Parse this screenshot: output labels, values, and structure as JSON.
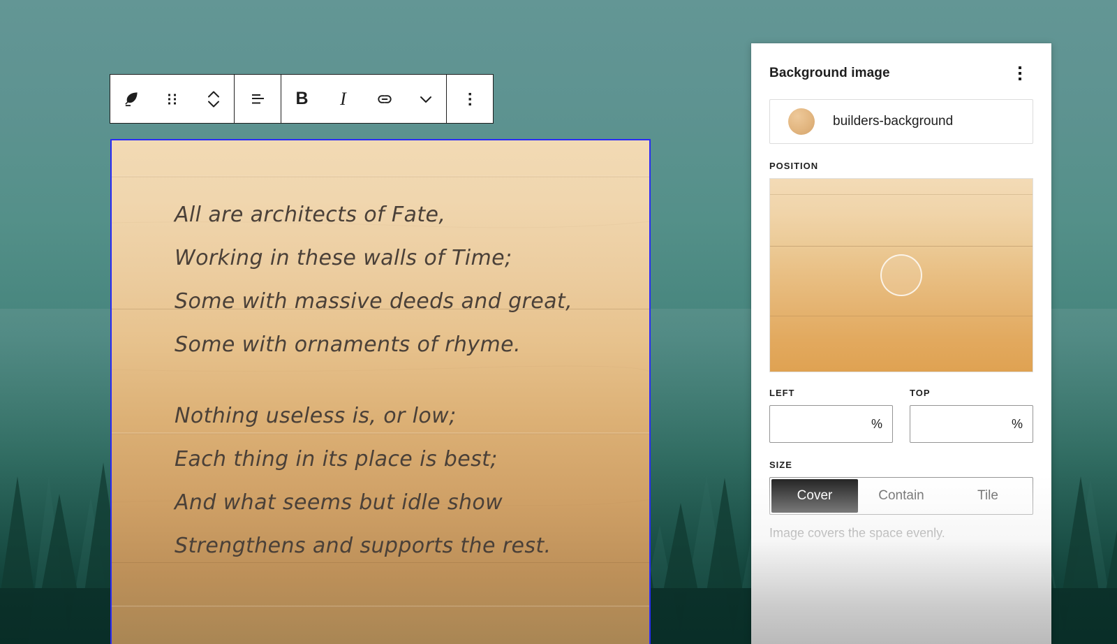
{
  "backdrop": {
    "description": "misty-forest-photograph",
    "sky_color": "#639695",
    "ground_color": "#093029"
  },
  "toolbar": {
    "groups": [
      {
        "name": "block-controls",
        "buttons": [
          {
            "icon": "quill-pen-icon",
            "label": "Verse"
          },
          {
            "icon": "drag-handle-icon",
            "label": "Drag"
          },
          {
            "icon": "move-up-down-icon",
            "label": "Move up or down"
          }
        ]
      },
      {
        "name": "alignment",
        "buttons": [
          {
            "icon": "align-text-left-icon",
            "label": "Align text"
          }
        ]
      },
      {
        "name": "formatting",
        "buttons": [
          {
            "icon": "bold-icon",
            "label": "B"
          },
          {
            "icon": "italic-icon",
            "label": "I"
          },
          {
            "icon": "link-icon",
            "label": "Link"
          },
          {
            "icon": "chevron-down-icon",
            "label": "More rich text controls"
          }
        ]
      },
      {
        "name": "options",
        "buttons": [
          {
            "icon": "vertical-ellipsis-icon",
            "label": "Options"
          }
        ]
      }
    ]
  },
  "content_block": {
    "type": "verse",
    "selection_color": "#2b2bf4",
    "stanzas": [
      [
        "All are architects of Fate,",
        "Working in these walls of Time;",
        "Some with massive deeds and great,",
        "Some with ornaments of rhyme."
      ],
      [
        "Nothing useless is, or low;",
        "Each thing in its place is best;",
        "And what seems but idle show",
        "Strengthens and supports the rest."
      ]
    ]
  },
  "panel": {
    "title": "Background image",
    "more_options_icon": "vertical-ellipsis-icon",
    "media": {
      "thumbnail_icon": "image-thumbnail-circle",
      "name": "builders-background"
    },
    "position": {
      "label": "POSITION",
      "handle_icon": "position-drag-handle-icon",
      "fields": [
        {
          "label": "LEFT",
          "value": "",
          "placeholder": "",
          "unit": "%"
        },
        {
          "label": "TOP",
          "value": "",
          "placeholder": "",
          "unit": "%"
        }
      ]
    },
    "size": {
      "label": "SIZE",
      "options": [
        "Cover",
        "Contain",
        "Tile"
      ],
      "selected": "Cover",
      "help_text": "Image covers the space evenly."
    }
  }
}
